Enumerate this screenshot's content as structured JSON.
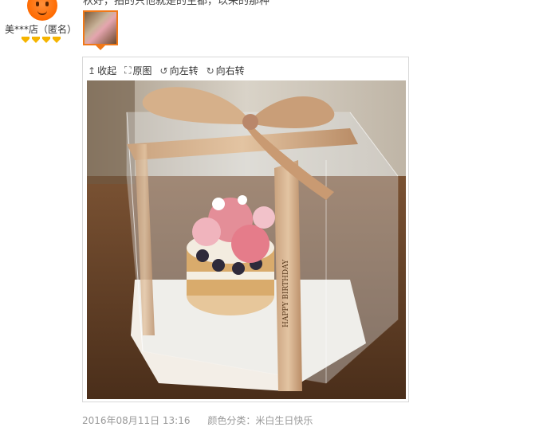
{
  "reviewer": {
    "name": "美***店（匿名）",
    "top_text": "秋好，拍的只他就是的主都，以来的那种"
  },
  "toolbar": {
    "collapse": "收起",
    "original": "原图",
    "rotate_left": "向左转",
    "rotate_right": "向右转"
  },
  "photo": {
    "ribbon_text": "HAPPY BIRTHDAY"
  },
  "meta": {
    "date": "2016年08月11日 13:16",
    "color_label": "颜色分类：米白生日快乐"
  },
  "colors": {
    "accent": "#f07818",
    "badge": "#f5b400"
  }
}
